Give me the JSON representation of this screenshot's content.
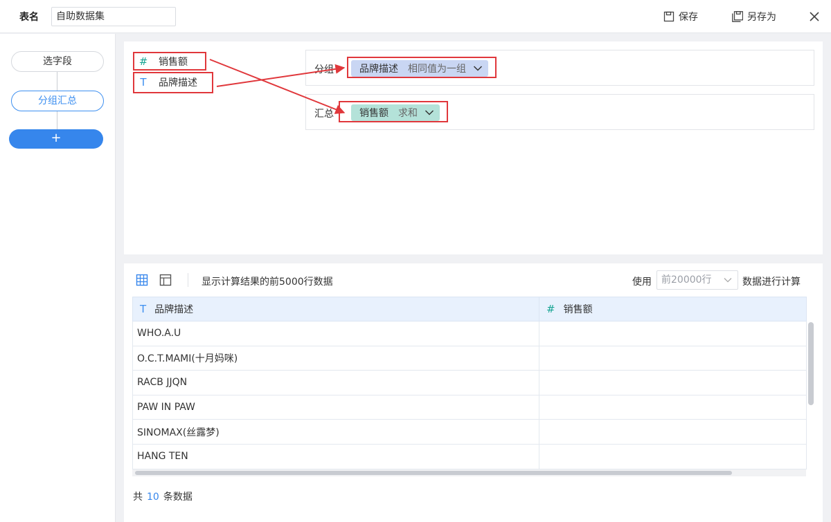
{
  "header": {
    "table_name_label": "表名",
    "table_name_value": "自助数据集",
    "save_label": "保存",
    "save_as_label": "另存为"
  },
  "sidebar": {
    "steps": [
      "选字段",
      "分组汇总"
    ],
    "add_label": "+"
  },
  "fields": [
    {
      "type_glyph": "#",
      "name": "销售额"
    },
    {
      "type_glyph": "T",
      "name": "品牌描述"
    }
  ],
  "zones": {
    "group": {
      "label": "分组",
      "field": "品牌描述",
      "mode": "相同值为一组"
    },
    "summary": {
      "label": "汇总",
      "field": "销售额",
      "mode": "求和"
    }
  },
  "preview": {
    "info": "显示计算结果的前5000行数据",
    "use_label": "使用",
    "rows_option": "前20000行",
    "calc_label": "数据进行计算",
    "columns": [
      {
        "type_glyph": "T",
        "name": "品牌描述"
      },
      {
        "type_glyph": "#",
        "name": "销售额"
      }
    ],
    "rows": [
      [
        "WHO.A.U",
        ""
      ],
      [
        "O.C.T.MAMI(十月妈咪)",
        ""
      ],
      [
        "RACB JJQN",
        ""
      ],
      [
        "PAW IN PAW",
        ""
      ],
      [
        "SINOMAX(丝露梦)",
        ""
      ],
      [
        "HANG TEN",
        ""
      ]
    ],
    "total_prefix": "共",
    "total_count": "10",
    "total_suffix": "条数据"
  },
  "colors": {
    "accent": "#3686ec",
    "number_type": "#18a594",
    "highlight": "#e0373b",
    "group_pill": "#c9d6f3",
    "summary_pill": "#b4e2d9"
  }
}
